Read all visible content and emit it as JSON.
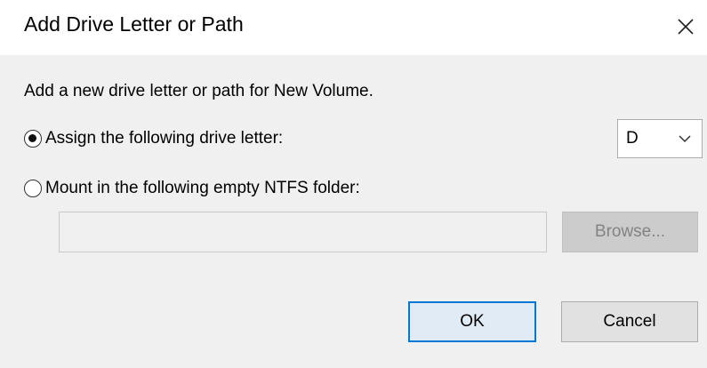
{
  "dialog": {
    "title": "Add Drive Letter or Path",
    "close_icon": "close-icon"
  },
  "content": {
    "description": "Add a new drive letter or path for New Volume.",
    "options": [
      {
        "label": "Assign the following drive letter:",
        "selected": true
      },
      {
        "label": "Mount in the following empty NTFS folder:",
        "selected": false
      }
    ],
    "drive_letter": {
      "value": "D",
      "icon": "chevron-down-icon"
    },
    "folder_path": {
      "value": "",
      "enabled": false
    },
    "browse_label": "Browse..."
  },
  "buttons": {
    "ok_label": "OK",
    "cancel_label": "Cancel"
  },
  "colors": {
    "content_background": "#f0f0f0",
    "accent": "#0078d7",
    "disabled_text": "#838383"
  }
}
